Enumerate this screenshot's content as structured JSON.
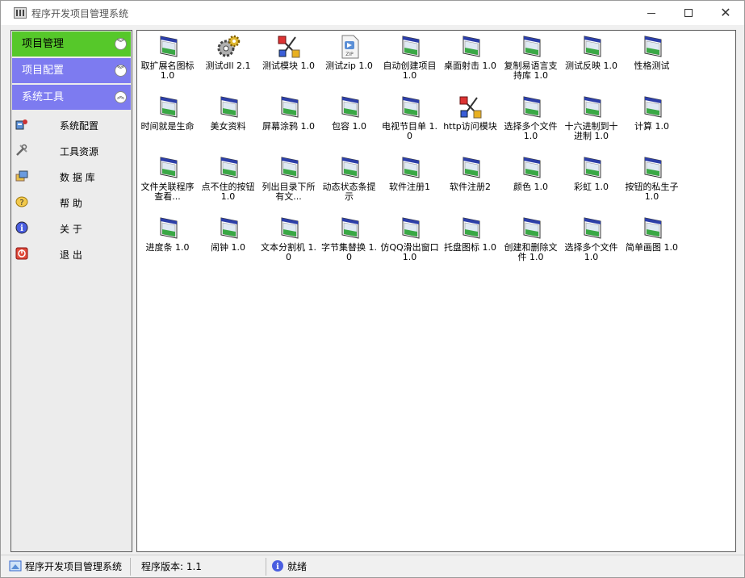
{
  "window": {
    "title": "程序开发项目管理系统"
  },
  "sidebar": {
    "groups": [
      {
        "label": "项目管理",
        "state": "active"
      },
      {
        "label": "项目配置",
        "state": "collapsed"
      },
      {
        "label": "系统工具",
        "state": "expanded"
      }
    ],
    "tools": [
      {
        "label": "系统配置",
        "icon": "config-icon"
      },
      {
        "label": "工具资源",
        "icon": "tools-icon"
      },
      {
        "label": "数 据 库",
        "icon": "database-icon"
      },
      {
        "label": "帮    助",
        "icon": "help-icon"
      },
      {
        "label": "关    于",
        "icon": "info-icon"
      },
      {
        "label": "退    出",
        "icon": "exit-icon"
      }
    ]
  },
  "apps": [
    {
      "label": "取扩展名图标 1.0",
      "icon": "window-icon"
    },
    {
      "label": "测试dll 2.1",
      "icon": "gears-icon"
    },
    {
      "label": "测试模块 1.0",
      "icon": "module-icon"
    },
    {
      "label": "测试zip 1.0",
      "icon": "zip-icon"
    },
    {
      "label": "自动创建项目 1.0",
      "icon": "window-icon"
    },
    {
      "label": "桌面射击 1.0",
      "icon": "window-icon"
    },
    {
      "label": "复制易语言支持库 1.0",
      "icon": "window-icon"
    },
    {
      "label": "测试反映 1.0",
      "icon": "window-icon"
    },
    {
      "label": "性格测试",
      "icon": "window-icon"
    },
    {
      "label": "时间就是生命",
      "icon": "window-icon"
    },
    {
      "label": "美女资料",
      "icon": "window-icon"
    },
    {
      "label": "屏幕涂鸦 1.0",
      "icon": "window-icon"
    },
    {
      "label": "包容 1.0",
      "icon": "window-icon"
    },
    {
      "label": "电视节目单 1.0",
      "icon": "window-icon"
    },
    {
      "label": "http访问模块",
      "icon": "module-icon"
    },
    {
      "label": "选择多个文件 1.0",
      "icon": "window-icon"
    },
    {
      "label": "十六进制到十进制 1.0",
      "icon": "window-icon"
    },
    {
      "label": "计算 1.0",
      "icon": "window-icon"
    },
    {
      "label": "文件关联程序查看...",
      "icon": "window-icon"
    },
    {
      "label": "点不住的按钮 1.0",
      "icon": "window-icon"
    },
    {
      "label": "列出目录下所有文...",
      "icon": "window-icon"
    },
    {
      "label": "动态状态条提示",
      "icon": "window-icon"
    },
    {
      "label": "软件注册1",
      "icon": "window-icon"
    },
    {
      "label": "软件注册2",
      "icon": "window-icon"
    },
    {
      "label": "颜色 1.0",
      "icon": "window-icon"
    },
    {
      "label": "彩虹 1.0",
      "icon": "window-icon"
    },
    {
      "label": "按钮的私生子 1.0",
      "icon": "window-icon"
    },
    {
      "label": "进度条 1.0",
      "icon": "window-icon"
    },
    {
      "label": "闹钟 1.0",
      "icon": "window-icon"
    },
    {
      "label": "文本分割机 1.0",
      "icon": "window-icon"
    },
    {
      "label": "字节集替换 1.0",
      "icon": "window-icon"
    },
    {
      "label": "仿QQ滑出窗口 1.0",
      "icon": "window-icon"
    },
    {
      "label": "托盘图标 1.0",
      "icon": "window-icon"
    },
    {
      "label": "创建和删除文件 1.0",
      "icon": "window-icon"
    },
    {
      "label": "选择多个文件 1.0",
      "icon": "window-icon"
    },
    {
      "label": "简单画图 1.0",
      "icon": "window-icon"
    }
  ],
  "statusbar": {
    "app_name": "程序开发项目管理系统",
    "version": "程序版本: 1.1",
    "status": "就绪"
  },
  "colors": {
    "active_group": "#56c82a",
    "group": "#7d7bf0"
  }
}
